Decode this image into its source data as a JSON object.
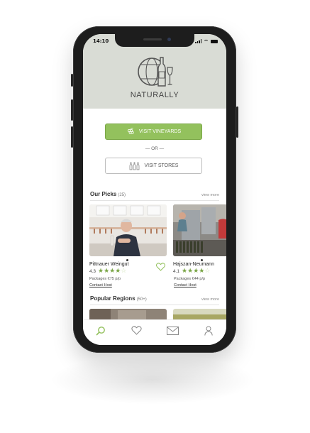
{
  "status_bar": {
    "time": "14:10"
  },
  "brand": {
    "name": "NATURALLY",
    "accent_color": "#93c15d",
    "header_bg": "#d9dcd5"
  },
  "actions": {
    "visit_vineyards": "VISIT VINEYARDS",
    "separator": "— OR —",
    "visit_stores": "VISIT STORES"
  },
  "picks": {
    "title": "Our Picks",
    "count": "(25)",
    "view_more": "view more",
    "items": [
      {
        "name": "Pittnauer Weingut",
        "rating": "4.3",
        "stars": 4,
        "packages": "Packages €75 p/p",
        "contact": "Contact Host"
      },
      {
        "name": "Hajszan-Neumann",
        "rating": "4.1",
        "stars": 4,
        "packages": "Packages €44 p/p",
        "contact": "Contact Host"
      }
    ]
  },
  "regions": {
    "title": "Popular Regions",
    "count": "(50+)",
    "view_more": "view more"
  },
  "tabbar": {
    "icons": [
      "search-icon",
      "heart-icon",
      "mail-icon",
      "profile-icon"
    ]
  }
}
